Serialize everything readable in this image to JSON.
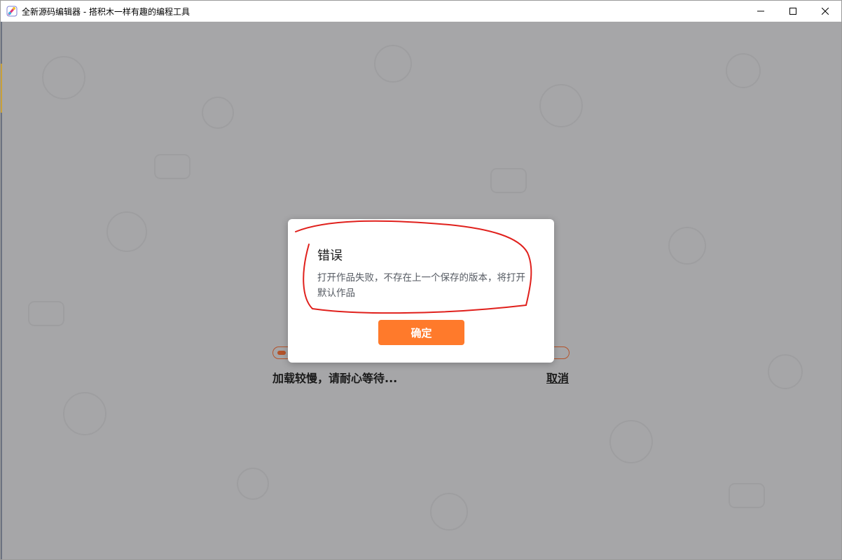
{
  "window": {
    "title": "全新源码编辑器 - 搭积木一样有趣的编程工具",
    "app_icon": "code-editor-app-icon",
    "controls": [
      "minimize-icon",
      "maximize-icon",
      "close-icon"
    ]
  },
  "loading": {
    "message": "加载较慢，请耐心等待...",
    "cancel_label": "取消",
    "progress_percent": 3
  },
  "dialog": {
    "title": "错误",
    "message": "打开作品失败，不存在上一个保存的版本，将打开默认作品",
    "confirm_label": "确定"
  },
  "colors": {
    "overlay": "#a6a6a8",
    "accent": "#ff7a2b",
    "progress": "#b4532a",
    "annotation_stroke": "#e0201c"
  }
}
